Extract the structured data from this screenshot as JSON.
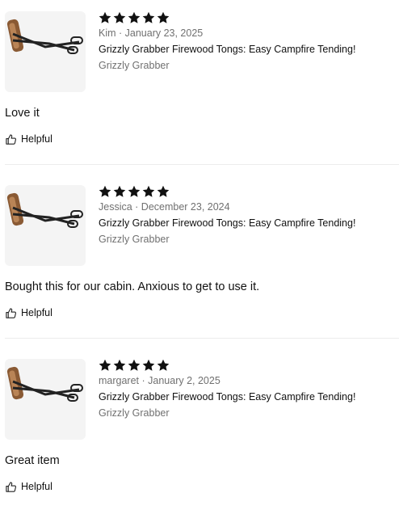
{
  "reviews": [
    {
      "rating": 5,
      "author": "Kim",
      "date": "January 23, 2025",
      "product_title": "Grizzly Grabber Firewood Tongs: Easy Campfire Tending!",
      "brand": "Grizzly Grabber",
      "body": "Love it",
      "helpful_label": "Helpful"
    },
    {
      "rating": 5,
      "author": "Jessica",
      "date": "December 23, 2024",
      "product_title": "Grizzly Grabber Firewood Tongs: Easy Campfire Tending!",
      "brand": "Grizzly Grabber",
      "body": "Bought this for our cabin. Anxious to get to use it.",
      "helpful_label": "Helpful"
    },
    {
      "rating": 5,
      "author": "margaret",
      "date": "January 2, 2025",
      "product_title": "Grizzly Grabber Firewood Tongs: Easy Campfire Tending!",
      "brand": "Grizzly Grabber",
      "body": "Great item",
      "helpful_label": "Helpful"
    }
  ],
  "colors": {
    "star": "#111111",
    "muted_text": "#707070",
    "thumb_bg": "#f4f4f4",
    "divider": "#ececec"
  },
  "icons": {
    "star": "star-icon",
    "helpful": "thumbs-up-icon",
    "product": "firewood-tongs-image"
  }
}
